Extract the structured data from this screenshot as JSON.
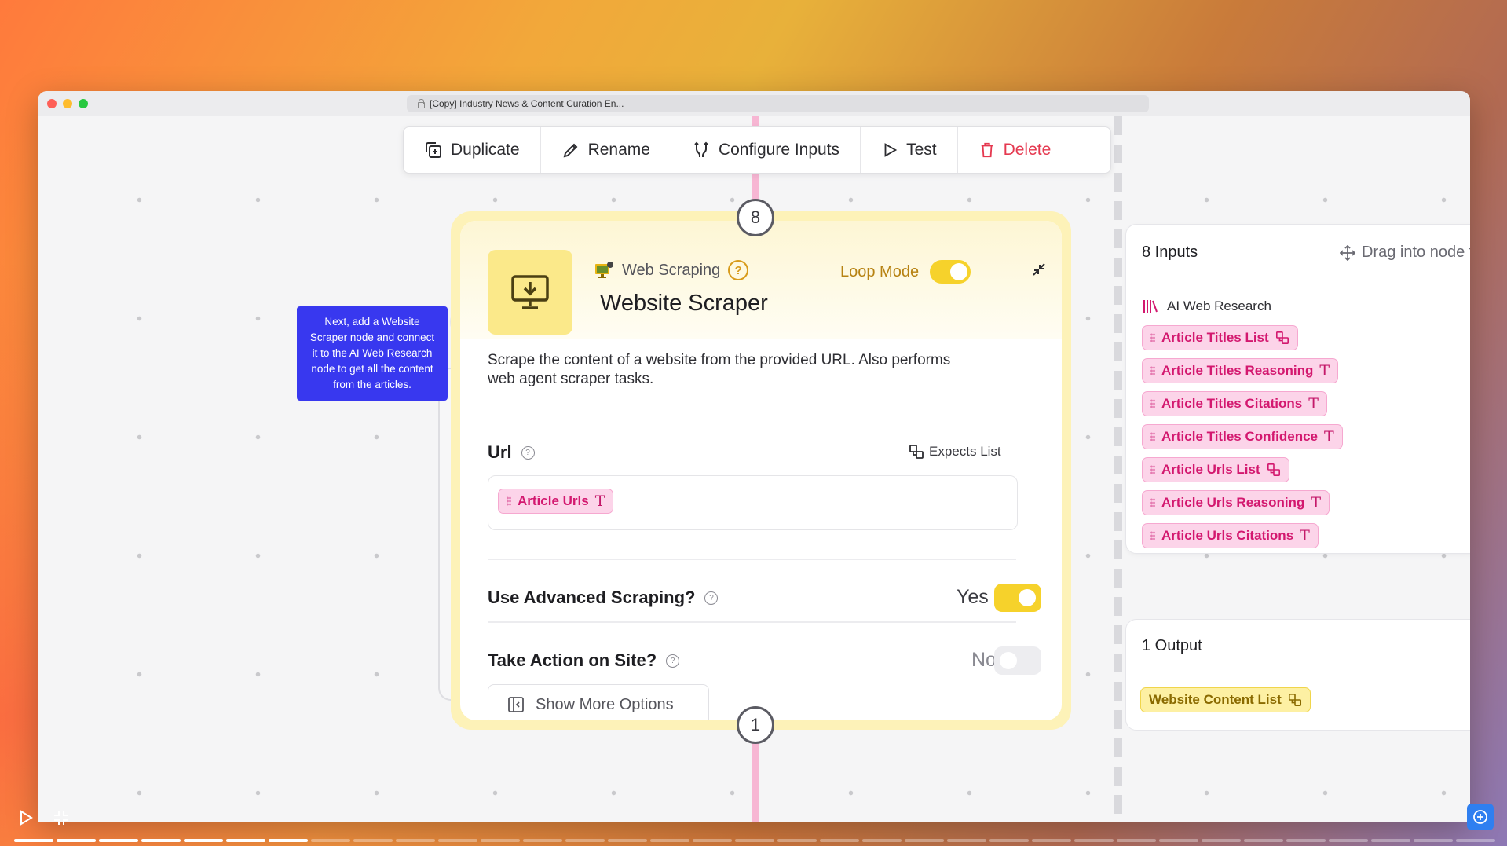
{
  "window": {
    "address_bar_title": "[Copy] Industry News & Content Curation En..."
  },
  "toolbar": {
    "duplicate_label": "Duplicate",
    "rename_label": "Rename",
    "configure_inputs_label": "Configure Inputs",
    "test_label": "Test",
    "delete_label": "Delete"
  },
  "node": {
    "top_badge": "8",
    "bottom_badge": "1",
    "category": "Web Scraping",
    "loop_mode_label": "Loop Mode",
    "loop_mode_on": true,
    "title": "Website Scraper",
    "description": "Scrape the content of a website from the provided URL. Also performs web agent scraper tasks.",
    "url_field": {
      "label": "Url",
      "expects_label": "Expects List",
      "value_chip": "Article Urls"
    },
    "advanced_scraping": {
      "label": "Use Advanced Scraping?",
      "value": "Yes",
      "on": true
    },
    "take_action": {
      "label": "Take Action on Site?",
      "value": "No",
      "on": false
    },
    "show_more_label": "Show More Options"
  },
  "tooltip": {
    "text": "Next, add a Website Scraper node and connect it to the AI Web Research node to get all the content from the articles."
  },
  "inputs_panel": {
    "title": "8 Inputs",
    "drag_hint": "Drag into node fiel",
    "source_name": "AI Web Research",
    "items": [
      {
        "label": "Article Titles List",
        "type": "list"
      },
      {
        "label": "Article Titles Reasoning",
        "type": "text"
      },
      {
        "label": "Article Titles Citations",
        "type": "text"
      },
      {
        "label": "Article Titles Confidence",
        "type": "text"
      },
      {
        "label": "Article Urls List",
        "type": "list"
      },
      {
        "label": "Article Urls Reasoning",
        "type": "text"
      },
      {
        "label": "Article Urls Citations",
        "type": "text"
      }
    ]
  },
  "output_panel": {
    "title": "1 Output",
    "items": [
      {
        "label": "Website Content List",
        "type": "list"
      }
    ]
  },
  "player": {
    "progress_segments_total": 35,
    "progress_segments_done": 7
  },
  "colors": {
    "accent_yellow": "#f6d22b",
    "chip_pink": "#d3186f",
    "tooltip_blue": "#3838ef",
    "delete_red": "#e53950"
  }
}
